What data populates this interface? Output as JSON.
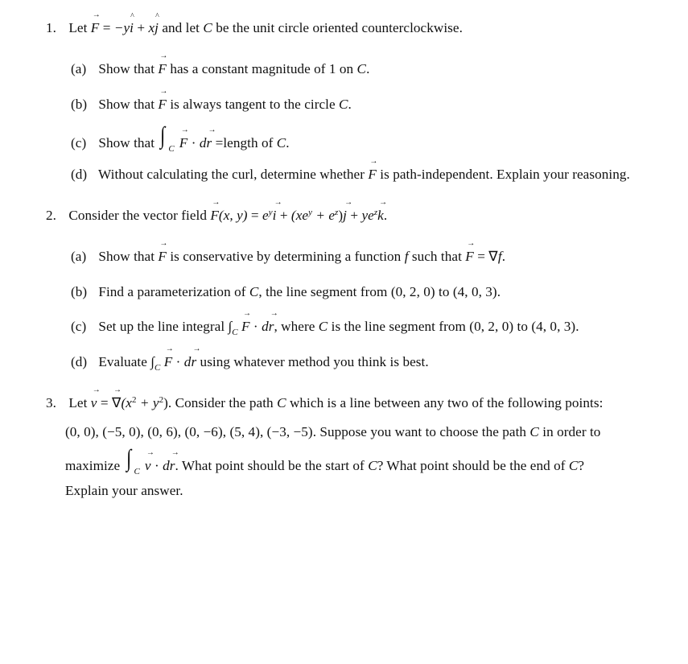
{
  "problems": [
    {
      "number": "1.",
      "intro": {
        "lead": "Let",
        "F": "F",
        "eq": "=",
        "expr1": "−y",
        "i": "i",
        "plus": "+",
        "x": "x",
        "j": "j",
        "rest": "and let",
        "C": "C",
        "tail": "be the unit circle oriented counterclockwise."
      },
      "parts": [
        {
          "label": "(a)",
          "pre": "Show that",
          "F": "F",
          "post": "has a constant magnitude of 1 on",
          "C": "C",
          "end": "."
        },
        {
          "label": "(b)",
          "pre": "Show that",
          "F": "F",
          "post": "is always tangent to the circle",
          "C": "C",
          "end": "."
        },
        {
          "label": "(c)",
          "pre": "Show that",
          "integral": "∫",
          "sub": "C",
          "F": "F",
          "dot": "·",
          "d": "d",
          "r": "r",
          "post": "=length of",
          "C": "C",
          "end": "."
        },
        {
          "label": "(d)",
          "pre": "Without calculating the curl, determine whether",
          "F": "F",
          "post": "is path-independent. Explain your reasoning."
        }
      ]
    },
    {
      "number": "2.",
      "intro": {
        "lead": "Consider the vector field",
        "F": "F",
        "args": "(x, y)",
        "eq": "=",
        "term1_base": "e",
        "term1_exp": "y",
        "i": "i",
        "plus1": "+",
        "open": "(xe",
        "term2_exp": "y",
        "mid": "+ e",
        "term3_exp": "z",
        "close": ")",
        "j": "j",
        "plus2": "+",
        "ye": "ye",
        "term4_exp": "z",
        "k": "k",
        "end": "."
      },
      "parts": [
        {
          "label": "(a)",
          "pre": "Show that",
          "F": "F",
          "mid": "is conservative by determining a function",
          "f": "f",
          "post": "such that",
          "F2": "F",
          "eq": "=",
          "nabla": "∇",
          "f2": "f",
          "end": "."
        },
        {
          "label": "(b)",
          "pre": "Find a parameterization of",
          "C": "C",
          "post": ", the line segment from (0, 2, 0) to (4, 0, 3)."
        },
        {
          "label": "(c)",
          "pre": "Set up the line integral",
          "integral": "∫",
          "sub": "C",
          "F": "F",
          "dot": "·",
          "d": "d",
          "r": "r",
          "post": ", where",
          "C": "C",
          "tail": "is the line segment from (0, 2, 0) to (4, 0, 3)."
        },
        {
          "label": "(d)",
          "pre": "Evaluate",
          "integral": "∫",
          "sub": "C",
          "F": "F",
          "dot": "·",
          "d": "d",
          "r": "r",
          "post": "using whatever method you think is best."
        }
      ]
    },
    {
      "number": "3.",
      "line1": {
        "lead": "Let",
        "v": "v",
        "eq": "=",
        "nabla": "∇",
        "open": "(x",
        "exp1": "2",
        "mid": "+ y",
        "exp2": "2",
        "close": ").",
        "text": "Consider the path",
        "C": "C",
        "tail": "which is a line between any two of the following points:"
      },
      "points": [
        "(0, 0)",
        "(−5, 0)",
        "(0, 6)",
        "(0, −6)",
        "(5, 4)",
        "(−3, −5)"
      ],
      "line2_tail": ". Suppose you want to choose the path",
      "line2_C": "C",
      "line2_end": "in order to",
      "line3": {
        "lead": "maximize",
        "integral": "∫",
        "sub": "C",
        "v": "v",
        "dot": "·",
        "d": "d",
        "r": "r",
        "q1": ". What point should be the start of",
        "C1": "C",
        "q1end": "? What point should be the end of",
        "C2": "C",
        "q2end": "?"
      },
      "line4": "Explain your answer."
    }
  ]
}
